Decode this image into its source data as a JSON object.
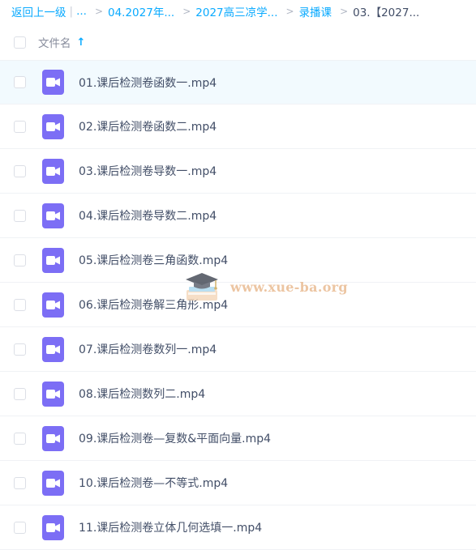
{
  "breadcrumb": {
    "back": "返回上一级",
    "ellipsis": "...",
    "items": [
      "04.2027年...",
      "2027高三凉学...",
      "录播课"
    ],
    "current": "03.【2027..."
  },
  "header": {
    "column_label": "文件名",
    "sort_icon": "arrow-up-icon"
  },
  "files": [
    {
      "name": "01.课后检测卷函数一.mp4",
      "icon": "video-file-icon"
    },
    {
      "name": "02.课后检测卷函数二.mp4",
      "icon": "video-file-icon"
    },
    {
      "name": "03.课后检测卷导数一.mp4",
      "icon": "video-file-icon"
    },
    {
      "name": "04.课后检测卷导数二.mp4",
      "icon": "video-file-icon"
    },
    {
      "name": "05.课后检测卷三角函数.mp4",
      "icon": "video-file-icon"
    },
    {
      "name": "06.课后检测卷解三角形.mp4",
      "icon": "video-file-icon"
    },
    {
      "name": "07.课后检测卷数列一.mp4",
      "icon": "video-file-icon"
    },
    {
      "name": "08.课后检测数列二.mp4",
      "icon": "video-file-icon"
    },
    {
      "name": "09.课后检测卷—复数&平面向量.mp4",
      "icon": "video-file-icon"
    },
    {
      "name": "10.课后检测卷—不等式.mp4",
      "icon": "video-file-icon"
    },
    {
      "name": "11.课后检测卷立体几何选填一.mp4",
      "icon": "video-file-icon"
    }
  ],
  "watermark": {
    "text": "www.xue-ba.org"
  },
  "colors": {
    "accent": "#09aaff",
    "file_icon": "#7c6ef5",
    "active_row": "#f2fafe"
  }
}
